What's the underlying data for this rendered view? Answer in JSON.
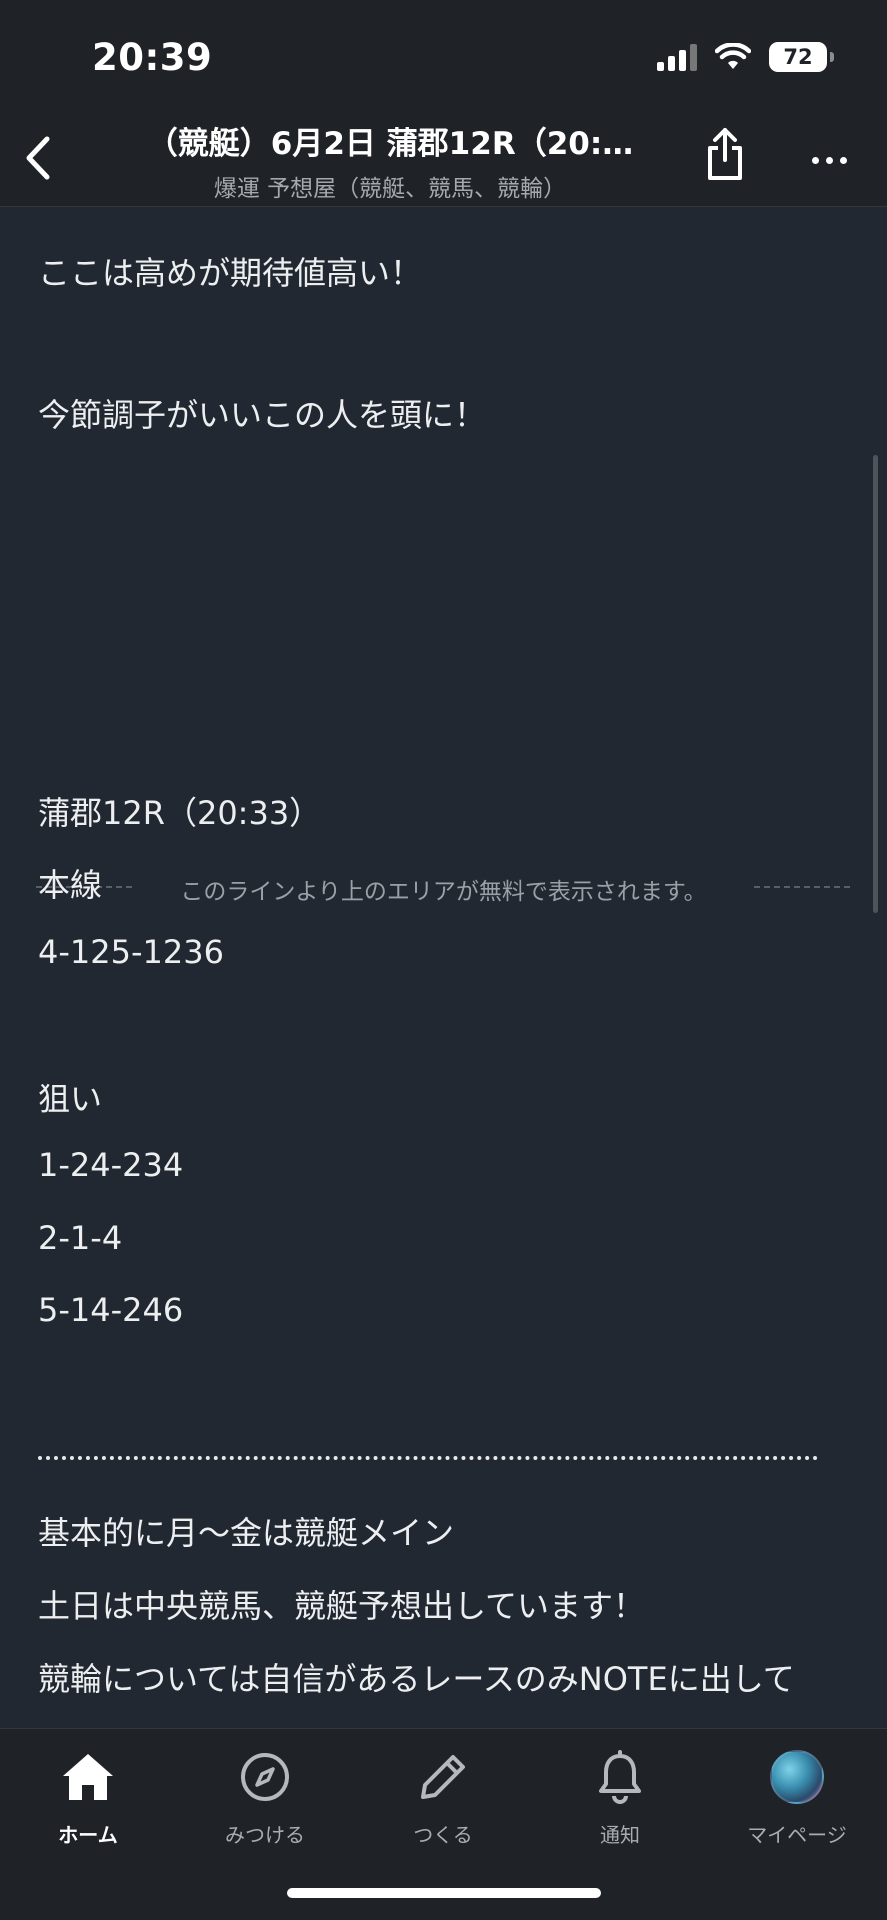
{
  "status_bar": {
    "time": "20:39",
    "battery": "72"
  },
  "header": {
    "title": "（競艇）6月2日 蒲郡12R（20:…",
    "subtitle": "爆運 予想屋（競艇、競馬、競輪）"
  },
  "article": {
    "intro_lines": [
      "ここは高めが期待値高い！",
      "今節調子がいいこの人を頭に！"
    ],
    "paywall_divider_text": "このラインより上のエリアが無料で表示されます。",
    "race_title": "蒲郡12R（20:33）",
    "main_label": "本線",
    "main_pick": "4-125-1236",
    "target_label": "狙い",
    "target_picks": [
      "1-24-234",
      "2-1-4",
      "5-14-246"
    ],
    "footer_lines": [
      "基本的に月〜金は競艇メイン",
      "土日は中央競馬、競艇予想出しています！",
      "競輪については自信があるレースのみNOTEに出して"
    ]
  },
  "tabbar": {
    "items": [
      {
        "label": "ホーム",
        "icon": "home-icon",
        "active": true
      },
      {
        "label": "みつける",
        "icon": "compass-icon",
        "active": false
      },
      {
        "label": "つくる",
        "icon": "pencil-icon",
        "active": false
      },
      {
        "label": "通知",
        "icon": "bell-icon",
        "active": false
      },
      {
        "label": "マイページ",
        "icon": "avatar",
        "active": false
      }
    ]
  },
  "colors": {
    "background": "#222831",
    "bar": "#1f2226",
    "text": "#eceef0",
    "muted": "#9ba0a6"
  }
}
